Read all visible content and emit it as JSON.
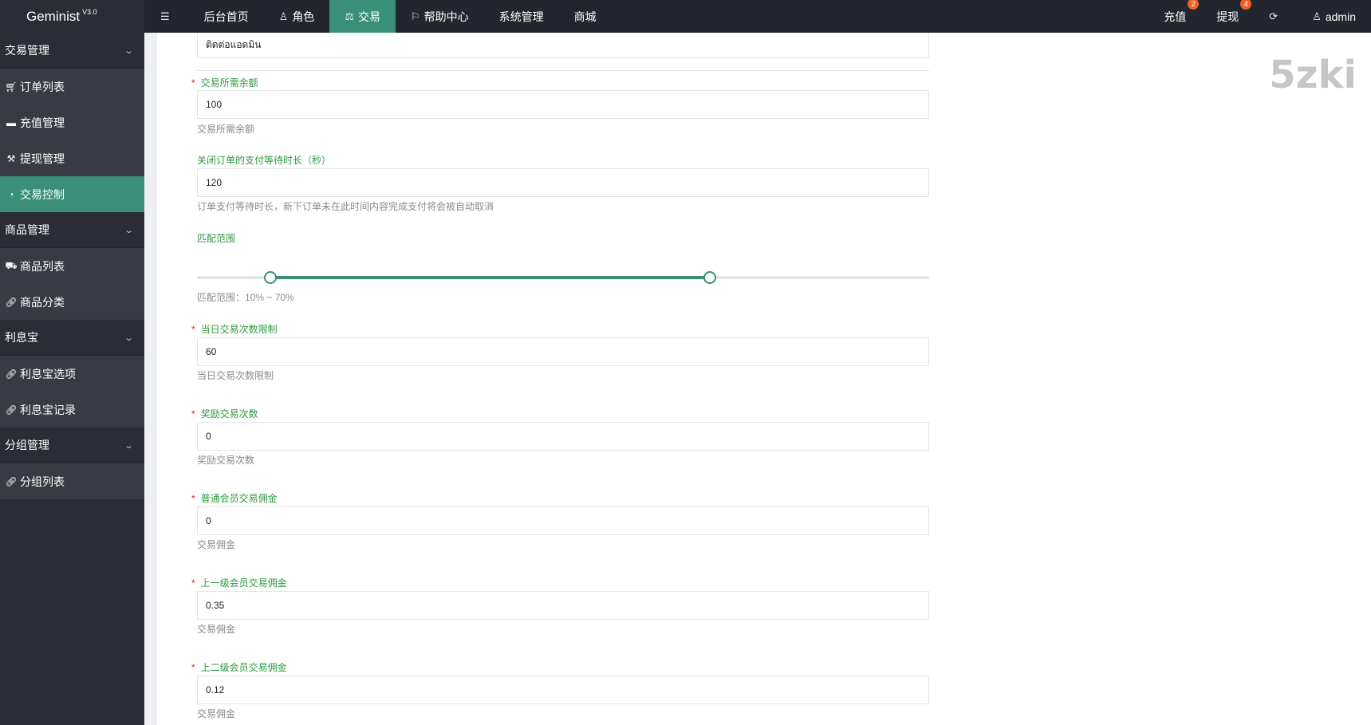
{
  "brand": {
    "name": "Geminist",
    "version": "V3.0"
  },
  "topnav": {
    "left": [
      {
        "label": "",
        "icon": "menu-icon"
      },
      {
        "label": "后台首页",
        "icon": ""
      },
      {
        "label": "角色",
        "icon": "user-icon"
      },
      {
        "label": "交易",
        "icon": "scale-icon",
        "active": true
      },
      {
        "label": "帮助中心",
        "icon": "flag-icon"
      },
      {
        "label": "系统管理",
        "icon": ""
      },
      {
        "label": "商城",
        "icon": ""
      }
    ],
    "recharge": {
      "label": "充值",
      "badge": "2"
    },
    "withdraw": {
      "label": "提现",
      "badge": "4"
    },
    "user": "admin"
  },
  "sidebar": {
    "trade_group": "交易管理",
    "order_list": "订单列表",
    "recharge_mgmt": "充值管理",
    "withdraw_mgmt": "提现管理",
    "trade_control": "交易控制",
    "goods_group": "商品管理",
    "goods_list": "商品列表",
    "goods_category": "商品分类",
    "interest_group": "利息宝",
    "interest_options": "利息宝选项",
    "interest_records": "利息宝记录",
    "group_group": "分组管理",
    "group_list": "分组列表"
  },
  "form": {
    "top_value": "ติดต่อแอดมิน",
    "balance": {
      "label": "交易所需余额",
      "value": "100",
      "help": "交易所需余额"
    },
    "wait": {
      "label": "关闭订单的支付等待时长（秒）",
      "value": "120",
      "help": "订单支付等待时长，新下订单未在此时间内容完成支付将会被自动取消"
    },
    "range": {
      "label": "匹配范围",
      "help": "匹配范围：10% ~ 70%",
      "low": 10,
      "high": 70
    },
    "daily_limit": {
      "label": "当日交易次数限制",
      "value": "60",
      "help": "当日交易次数限制"
    },
    "reward": {
      "label": "奖励交易次数",
      "value": "0",
      "help": "奖励交易次数"
    },
    "commission": {
      "label": "普通会员交易佣金",
      "value": "0",
      "help": "交易佣金"
    },
    "up1": {
      "label": "上一级会员交易佣金",
      "value": "0.35",
      "help": "交易佣金"
    },
    "up2": {
      "label": "上二级会员交易佣金",
      "value": "0.12",
      "help": "交易佣金"
    }
  },
  "watermark": "5zki",
  "colors": {
    "accent": "#3a8f78",
    "label_green": "#2e9a3e",
    "badge": "#f0612a"
  }
}
